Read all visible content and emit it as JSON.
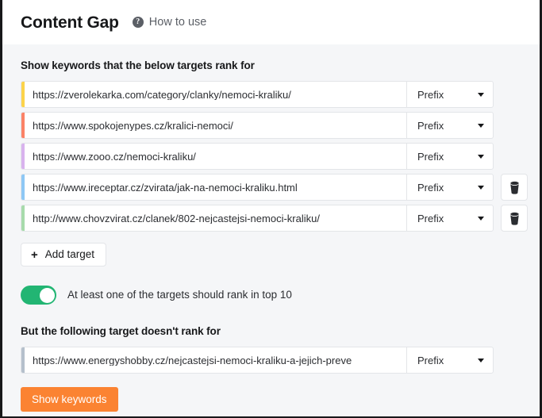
{
  "header": {
    "title": "Content Gap",
    "help_link": "How to use",
    "help_icon": "question-circle-icon"
  },
  "include_section": {
    "label": "Show keywords that the below targets rank for",
    "targets": [
      {
        "url": "https://zverolekarka.com/category/clanky/nemoci-kraliku/",
        "mode": "Prefix",
        "accent": "#fcd34a",
        "deletable": false
      },
      {
        "url": "https://www.spokojenypes.cz/kralici-nemoci/",
        "mode": "Prefix",
        "accent": "#fb8267",
        "deletable": false
      },
      {
        "url": "https://www.zooo.cz/nemoci-kraliku/",
        "mode": "Prefix",
        "accent": "#d9b3ee",
        "deletable": false
      },
      {
        "url": "https://www.ireceptar.cz/zvirata/jak-na-nemoci-kraliku.html",
        "mode": "Prefix",
        "accent": "#8ec8f5",
        "deletable": true
      },
      {
        "url": "http://www.chovzvirat.cz/clanek/802-nejcastejsi-nemoci-kraliku/",
        "mode": "Prefix",
        "accent": "#a7dbab",
        "deletable": true
      }
    ],
    "add_target_label": "Add target",
    "add_target_icon": "plus-icon",
    "delete_icon": "trash-icon",
    "dropdown_icon": "chevron-down-icon"
  },
  "toggle": {
    "label": "At least one of the targets should rank in top 10",
    "state": "on",
    "color": "#22b573"
  },
  "exclude_section": {
    "label": "But the following target doesn't rank for",
    "target": {
      "url": "https://www.energyshobby.cz/nejcastejsi-nemoci-kraliku-a-jejich-preve",
      "mode": "Prefix",
      "accent": "#b5c0cc"
    }
  },
  "submit": {
    "label": "Show keywords",
    "color": "#fb8332"
  }
}
